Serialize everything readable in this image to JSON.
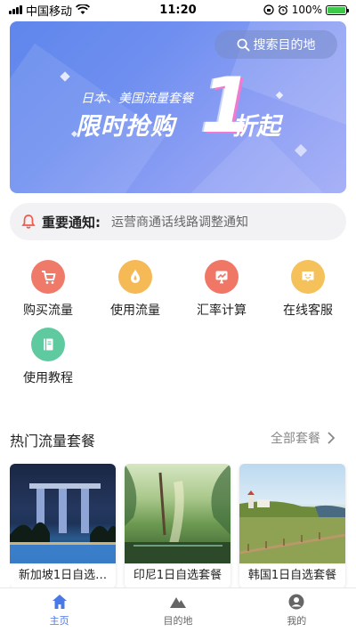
{
  "status_bar": {
    "carrier": "中国移动",
    "time": "11:20",
    "battery": "100%"
  },
  "banner": {
    "search_placeholder": "搜索目的地",
    "promo_subtitle": "日本、美国流量套餐",
    "promo_title": "限时抢购",
    "promo_number": "1",
    "promo_suffix": "折起"
  },
  "notice": {
    "label": "重要通知:",
    "text": "运营商通话线路调整通知"
  },
  "functions": [
    {
      "label": "购买流量",
      "icon": "cart-icon",
      "color": "#ef7a6a"
    },
    {
      "label": "使用流量",
      "icon": "drop-icon",
      "color": "#f5b955"
    },
    {
      "label": "汇率计算",
      "icon": "calculator-icon",
      "color": "#f07766"
    },
    {
      "label": "在线客服",
      "icon": "chat-smile-icon",
      "color": "#f5c15a"
    },
    {
      "label": "使用教程",
      "icon": "book-icon",
      "color": "#5fcaa0"
    }
  ],
  "section": {
    "title": "热门流量套餐",
    "more": "全部套餐"
  },
  "packages": [
    {
      "title": "新加坡1日自选…"
    },
    {
      "title": "印尼1日自选套餐"
    },
    {
      "title": "韩国1日自选套餐"
    }
  ],
  "tabs": [
    {
      "label": "主页",
      "icon": "home-icon",
      "active": true
    },
    {
      "label": "目的地",
      "icon": "mountain-icon",
      "active": false
    },
    {
      "label": "我的",
      "icon": "user-icon",
      "active": false
    }
  ],
  "colors": {
    "accent": "#4a78e6",
    "notice_icon": "#ef5a4c"
  }
}
